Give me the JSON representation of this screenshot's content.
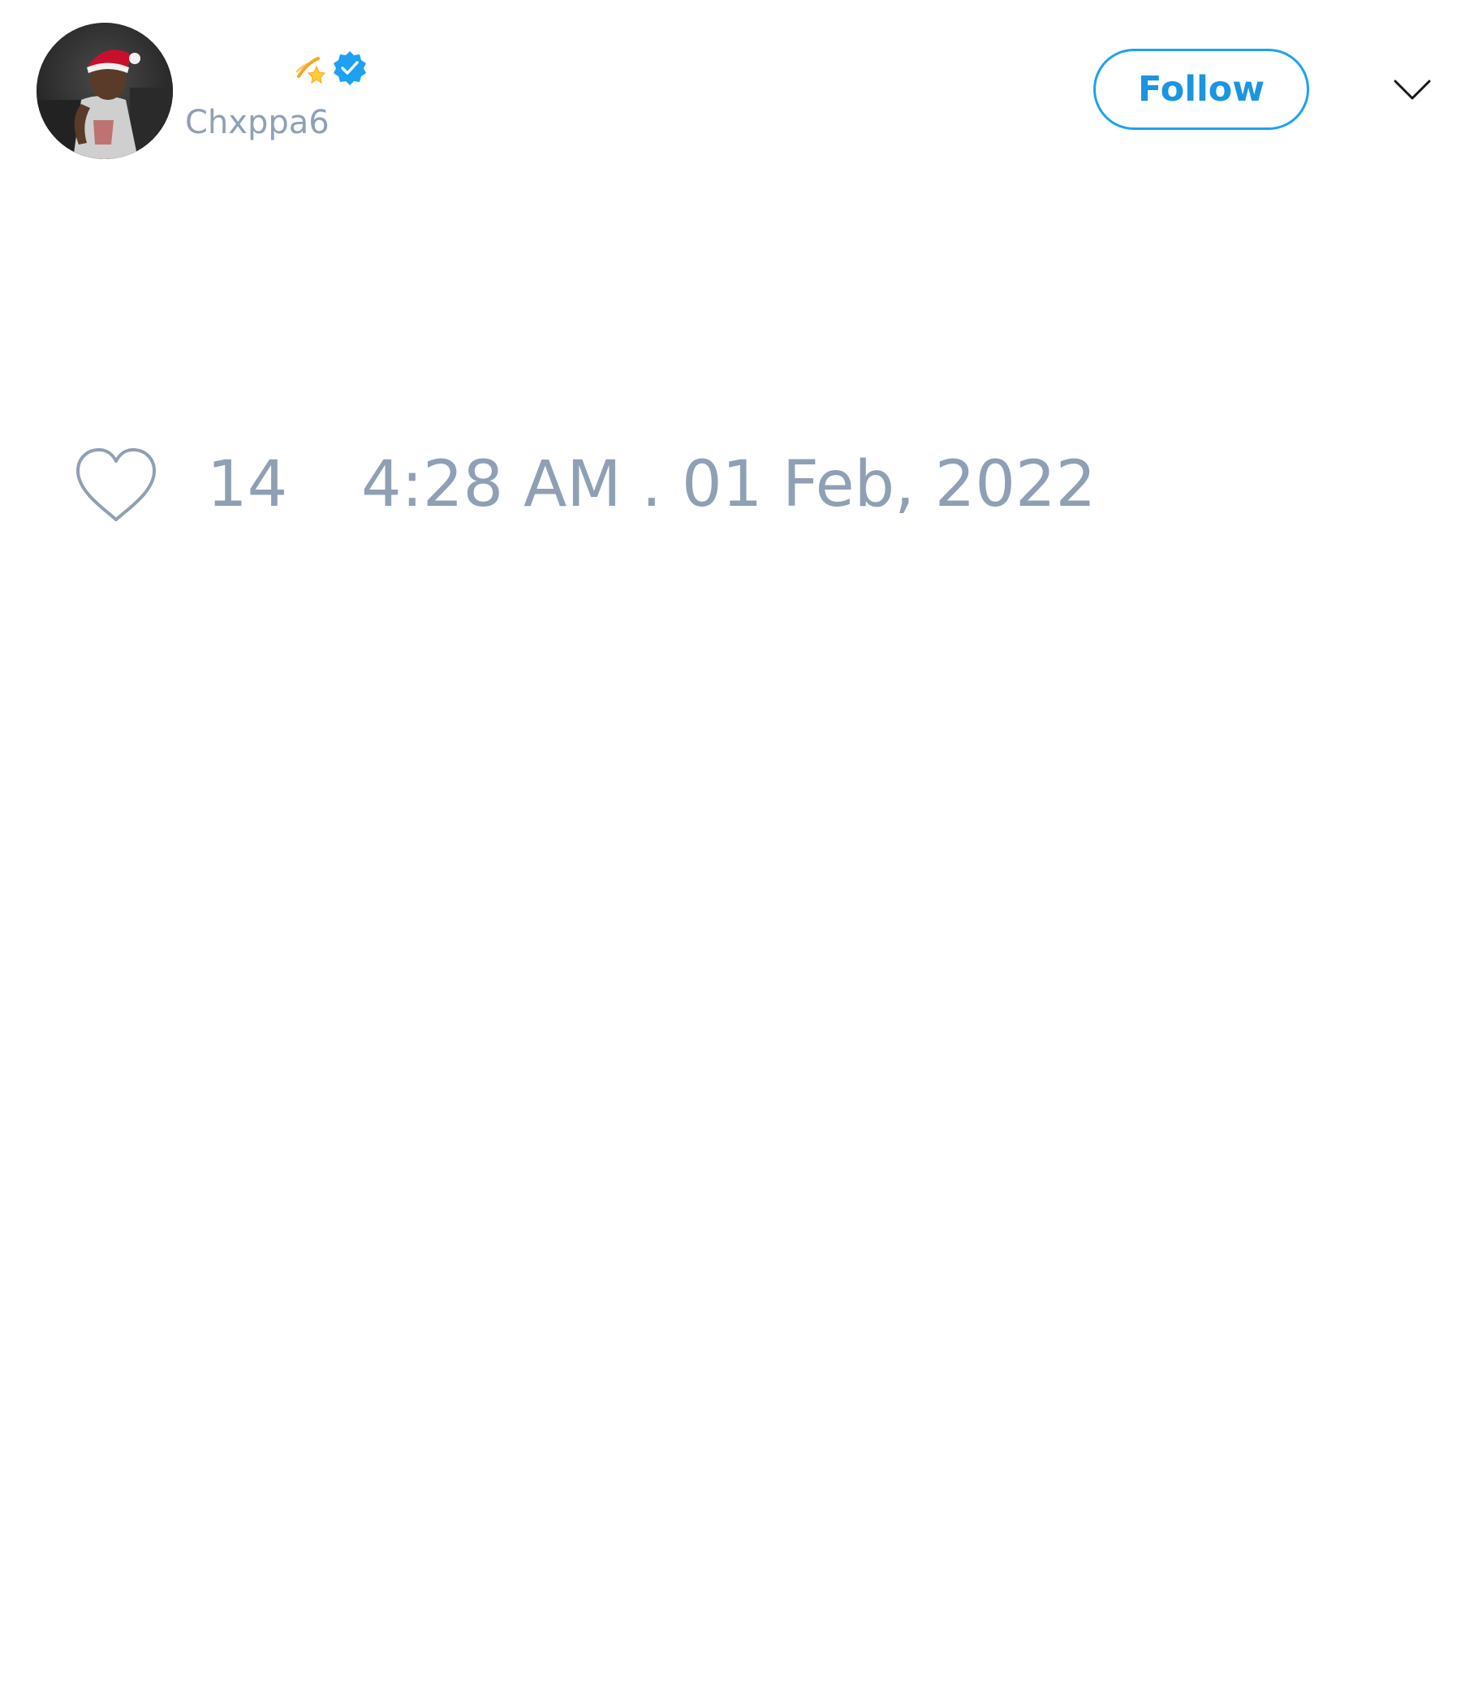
{
  "tweet": {
    "author": {
      "display_name": "",
      "handle": "Chxppa6",
      "name_emoji": "dizzy-emoji",
      "verified": true,
      "avatar_description": "profile-photo"
    },
    "actions": {
      "follow_label": "Follow",
      "menu_icon": "chevron-down-icon"
    },
    "footer": {
      "like_icon": "heart-icon",
      "like_count": "14",
      "timestamp": "4:28 AM . 01 Feb, 2022"
    }
  },
  "colors": {
    "accent": "#1da1f2",
    "muted_text": "#8fa0b5",
    "background": "#ffffff",
    "verified_badge": "#1da1f2"
  }
}
